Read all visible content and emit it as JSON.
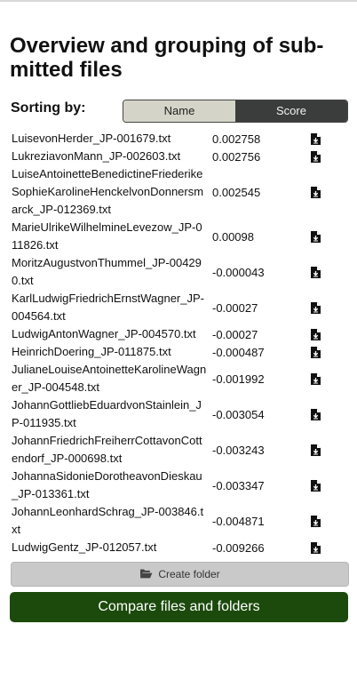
{
  "header": {
    "title": "Overview and grouping of sub-mitted files"
  },
  "sorting": {
    "label": "Sorting by:",
    "options": [
      "Name",
      "Score"
    ],
    "selected": "Score"
  },
  "files": [
    {
      "name": "LuisevonHerder_JP-001679.txt",
      "score": "0.002758"
    },
    {
      "name": "LukreziavonMann_JP-002603.txt",
      "score": "0.002756"
    },
    {
      "name": "LuiseAntoinetteBenedictineFriederikeSophieKarolineHenckelvonDonnersmarck_JP-012369.txt",
      "score": "0.002545"
    },
    {
      "name": "MarieUlrikeWilhelmineLevezow_JP-011826.txt",
      "score": "0.00098"
    },
    {
      "name": "MoritzAugustvonThummel_JP-004290.txt",
      "score": "-0.000043"
    },
    {
      "name": "KarlLudwigFriedrichErnstWagner_JP-004564.txt",
      "score": "-0.00027"
    },
    {
      "name": "LudwigAntonWagner_JP-004570.txt",
      "score": "-0.00027"
    },
    {
      "name": "HeinrichDoering_JP-011875.txt",
      "score": "-0.000487"
    },
    {
      "name": "JulianeLouiseAntoinetteKarolineWagner_JP-004548.txt",
      "score": "-0.001992"
    },
    {
      "name": "JohannGottliebEduardvonStainlein_JP-011935.txt",
      "score": "-0.003054"
    },
    {
      "name": "JohannFriedrichFreiherrCottavonCottendorf_JP-000698.txt",
      "score": "-0.003243"
    },
    {
      "name": "JohannaSidonieDorotheavonDieskau_JP-013361.txt",
      "score": "-0.003347"
    },
    {
      "name": "JohannLeonhardSchrag_JP-003846.txt",
      "score": "-0.004871"
    },
    {
      "name": "LudwigGentz_JP-012057.txt",
      "score": "-0.009266"
    }
  ],
  "actions": {
    "create_folder_label": "Create folder",
    "compare_label": "Compare files and folders"
  },
  "icons": {
    "download": "file-download-icon",
    "folder": "folder-open-icon"
  },
  "colors": {
    "compare_button": "#1b4a0c",
    "toggle_selected": "#3b3c3c",
    "toggle_unselected": "#d4d4c8"
  }
}
